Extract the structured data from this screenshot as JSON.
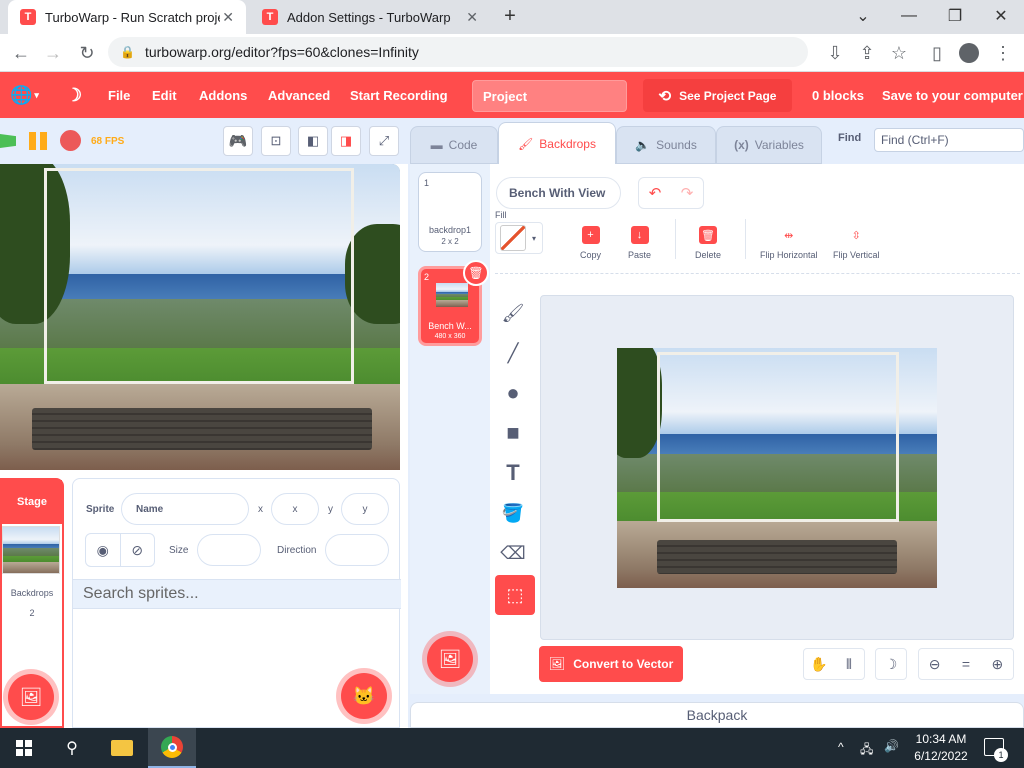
{
  "browser": {
    "tabs": [
      {
        "title": "TurboWarp - Run Scratch project",
        "favicon": "T"
      },
      {
        "title": "Addon Settings - TurboWarp",
        "favicon": "T"
      }
    ],
    "new_tab": "+",
    "url": "turbowarp.org/editor?fps=60&clones=Infinity"
  },
  "menu": {
    "file": "File",
    "edit": "Edit",
    "addons": "Addons",
    "advanced": "Advanced",
    "start_recording": "Start Recording",
    "project_title": "Project",
    "see_project_page": "See Project Page",
    "blocks": "0 blocks",
    "save": "Save to your computer",
    "accent": "#ff4c4c"
  },
  "stage": {
    "fps": "68 FPS"
  },
  "sprite_info": {
    "sprite_label": "Sprite",
    "name_placeholder": "Name",
    "x_label": "x",
    "x_placeholder": "x",
    "y_label": "y",
    "y_placeholder": "y",
    "size_label": "Size",
    "direction_label": "Direction",
    "search_placeholder": "Search sprites..."
  },
  "stage_panel": {
    "header": "Stage",
    "backdrops_label": "Backdrops",
    "backdrops_count": "2"
  },
  "editor": {
    "tabs": [
      "Code",
      "Backdrops",
      "Sounds",
      "Variables"
    ],
    "active_tab": "Backdrops",
    "find_label": "Find",
    "find_placeholder": "Find (Ctrl+F)",
    "costumes": [
      {
        "num": "1",
        "name": "backdrop1",
        "size": "2 x 2"
      },
      {
        "num": "2",
        "name": "Bench W...",
        "size": "480 x 360"
      }
    ],
    "costume_name": "Bench With View",
    "fill_label": "Fill",
    "tools": [
      "Copy",
      "Paste",
      "Delete",
      "Flip Horizontal",
      "Flip Vertical"
    ],
    "convert": "Convert to Vector",
    "zoom_reset": "="
  },
  "backpack": "Backpack",
  "taskbar": {
    "time": "10:34 AM",
    "date": "6/12/2022",
    "notification_count": "1"
  }
}
